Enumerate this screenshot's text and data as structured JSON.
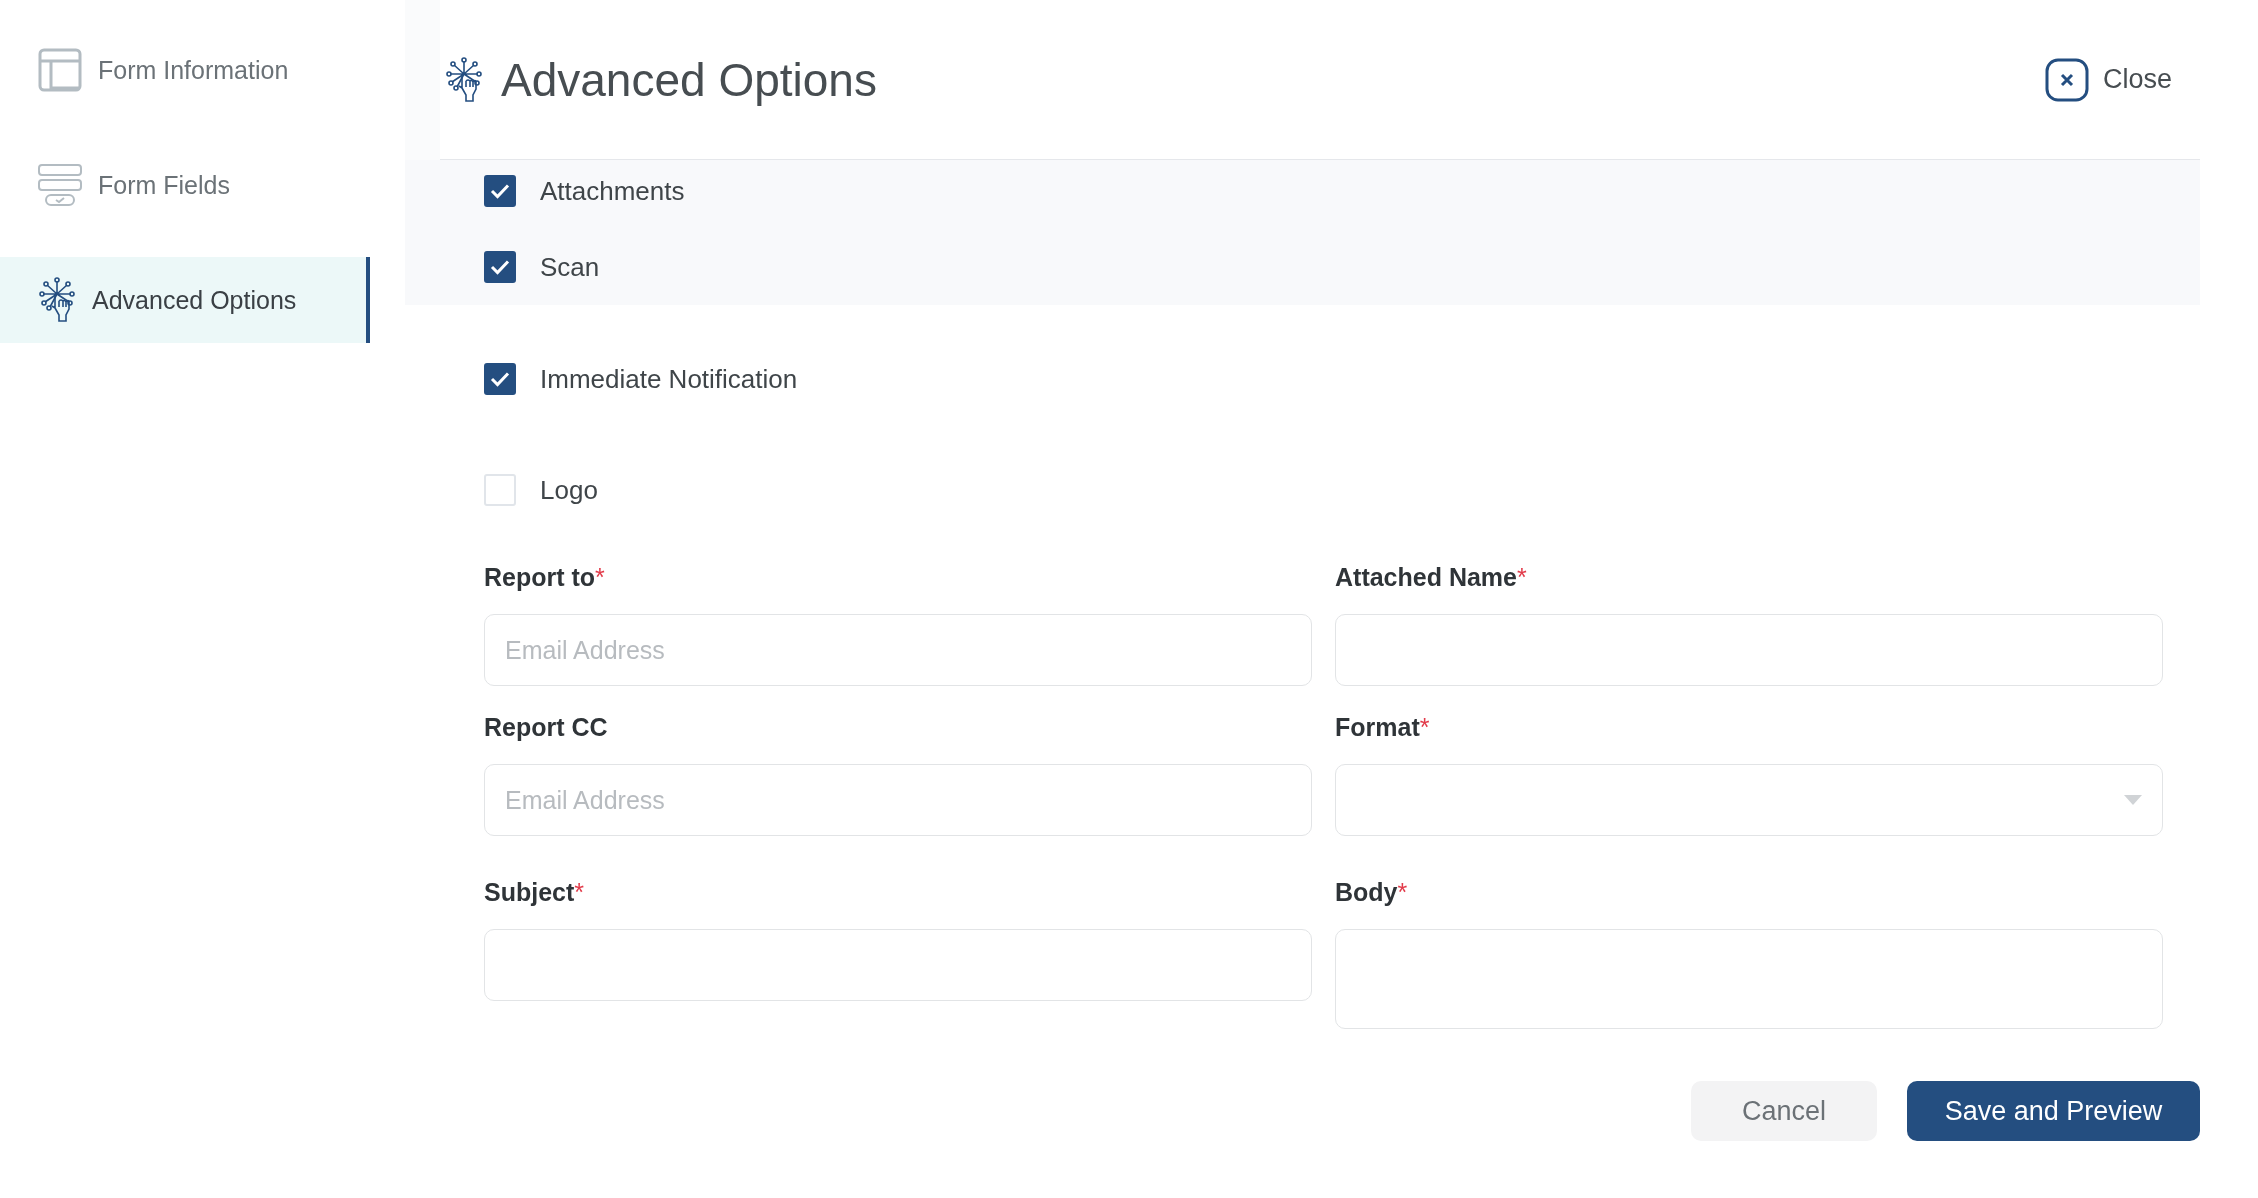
{
  "sidebar": {
    "items": [
      {
        "label": "Form Information",
        "kind": "layout",
        "selected": false
      },
      {
        "label": "Form Fields",
        "kind": "fields",
        "selected": false
      },
      {
        "label": "Advanced Options",
        "kind": "spark",
        "selected": true
      }
    ]
  },
  "header": {
    "title": "Advanced Options",
    "close": "Close"
  },
  "shaded_options": [
    {
      "label": "Attachments",
      "checked": true
    },
    {
      "label": "Scan",
      "checked": true
    }
  ],
  "options": [
    {
      "label": "Immediate Notification",
      "checked": true
    },
    {
      "label": "Logo",
      "checked": false
    }
  ],
  "fields": [
    {
      "label": "Report to",
      "required_mark": "*",
      "kind": "text",
      "placeholder": "Email Address"
    },
    {
      "label": "Attached Name",
      "required_mark": "*",
      "kind": "text"
    },
    {
      "label": "Report CC",
      "kind": "text",
      "placeholder": "Email Address"
    },
    {
      "label": "Format",
      "required_mark": "*",
      "kind": "select"
    },
    {
      "label": "Subject",
      "required_mark": "*",
      "kind": "text"
    },
    {
      "label": "Body",
      "required_mark": "*",
      "kind": "textarea"
    }
  ],
  "buttons": [
    {
      "label": "Cancel",
      "kind": "secondary"
    },
    {
      "label": "Save and Preview",
      "kind": "primary"
    }
  ]
}
